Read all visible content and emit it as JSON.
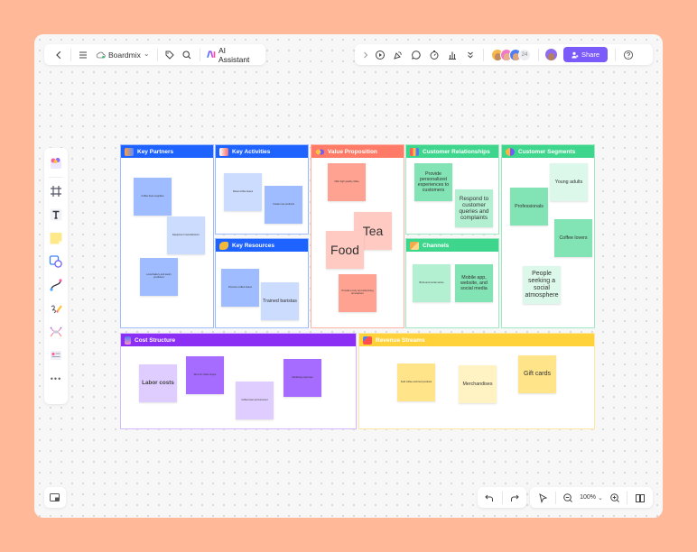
{
  "header": {
    "back_icon": "chevron-left-icon",
    "menu_icon": "hamburger-menu-icon",
    "app_name": "Boardmix",
    "app_chevron": "⌄",
    "tag_icon": "tag-icon",
    "search_icon": "search-icon",
    "ai_assistant_label": "AI Assistant"
  },
  "right_toolbar": {
    "collapse_icon": "chevron-right-icon",
    "present_icon": "play-icon",
    "celebrate_icon": "party-popper-icon",
    "comment_icon": "comment-icon",
    "timer_icon": "timer-icon",
    "vote_icon": "chart-bar-icon",
    "more_icon": "double-chevron-down-icon",
    "collaborator_count": "24",
    "share_label": "Share",
    "help_icon": "help-icon"
  },
  "colors": {
    "blue": "#1E62FF",
    "salmon": "#FF7B67",
    "green": "#3DD68C",
    "purple": "#8B2FF5",
    "yellow": "#FFD23C",
    "share": "#7B5CFA",
    "background": "#FFB898"
  },
  "canvas": {
    "key_partners": {
      "title": "Key Partners",
      "notes": [
        "Coffee bean suppliers",
        "Equipment manufacturers",
        "Local bakery and pastry producers"
      ]
    },
    "key_activities": {
      "title": "Key Activities",
      "notes": [
        "Roast coffee beans",
        "Create new products"
      ]
    },
    "key_resources": {
      "title": "Key Resources",
      "notes": [
        "Premium coffee beans",
        "Trained baristas"
      ]
    },
    "value_proposition": {
      "title": "Value Proposition",
      "notes": [
        "Offer high quality coffee",
        "Tea",
        "Food",
        "Provide a cozy and welcoming atmosphere"
      ]
    },
    "customer_relationships": {
      "title": "Customer Relationships",
      "notes": [
        "Provide personalized experiences to customers",
        "Respond to customer queries and complaints"
      ]
    },
    "channels": {
      "title": "Channels",
      "notes": [
        "Brick-and-mortar stores",
        "Mobile app, website, and social media"
      ]
    },
    "customer_segments": {
      "title": "Customer Segments",
      "notes": [
        "Young adults",
        "Professionals",
        "Coffee lovers",
        "People seeking a social atmosphere"
      ]
    },
    "cost_structure": {
      "title": "Cost Structure",
      "notes": [
        "Labor costs",
        "Rent for coffee shops",
        "Coffee bean procurement",
        "Marketing expenses"
      ]
    },
    "revenue_streams": {
      "title": "Revenue Streams",
      "notes": [
        "Sold coffee and food products",
        "Merchandises",
        "Gift cards"
      ]
    }
  },
  "left_tools": [
    "templates-icon",
    "frame-icon",
    "text-icon",
    "sticky-note-icon",
    "shapes-icon",
    "connector-icon",
    "pen-icon",
    "mindmap-icon",
    "more-templates-icon",
    "more-icon"
  ],
  "left_tools_more": "•••",
  "bottom": {
    "minimap_icon": "minimap-icon",
    "undo_icon": "undo-icon",
    "redo_icon": "redo-icon",
    "select_icon": "cursor-icon",
    "zoom_out_icon": "zoom-out-icon",
    "zoom_level": "100%",
    "zoom_in_icon": "zoom-in-icon",
    "book_icon": "book-icon"
  }
}
